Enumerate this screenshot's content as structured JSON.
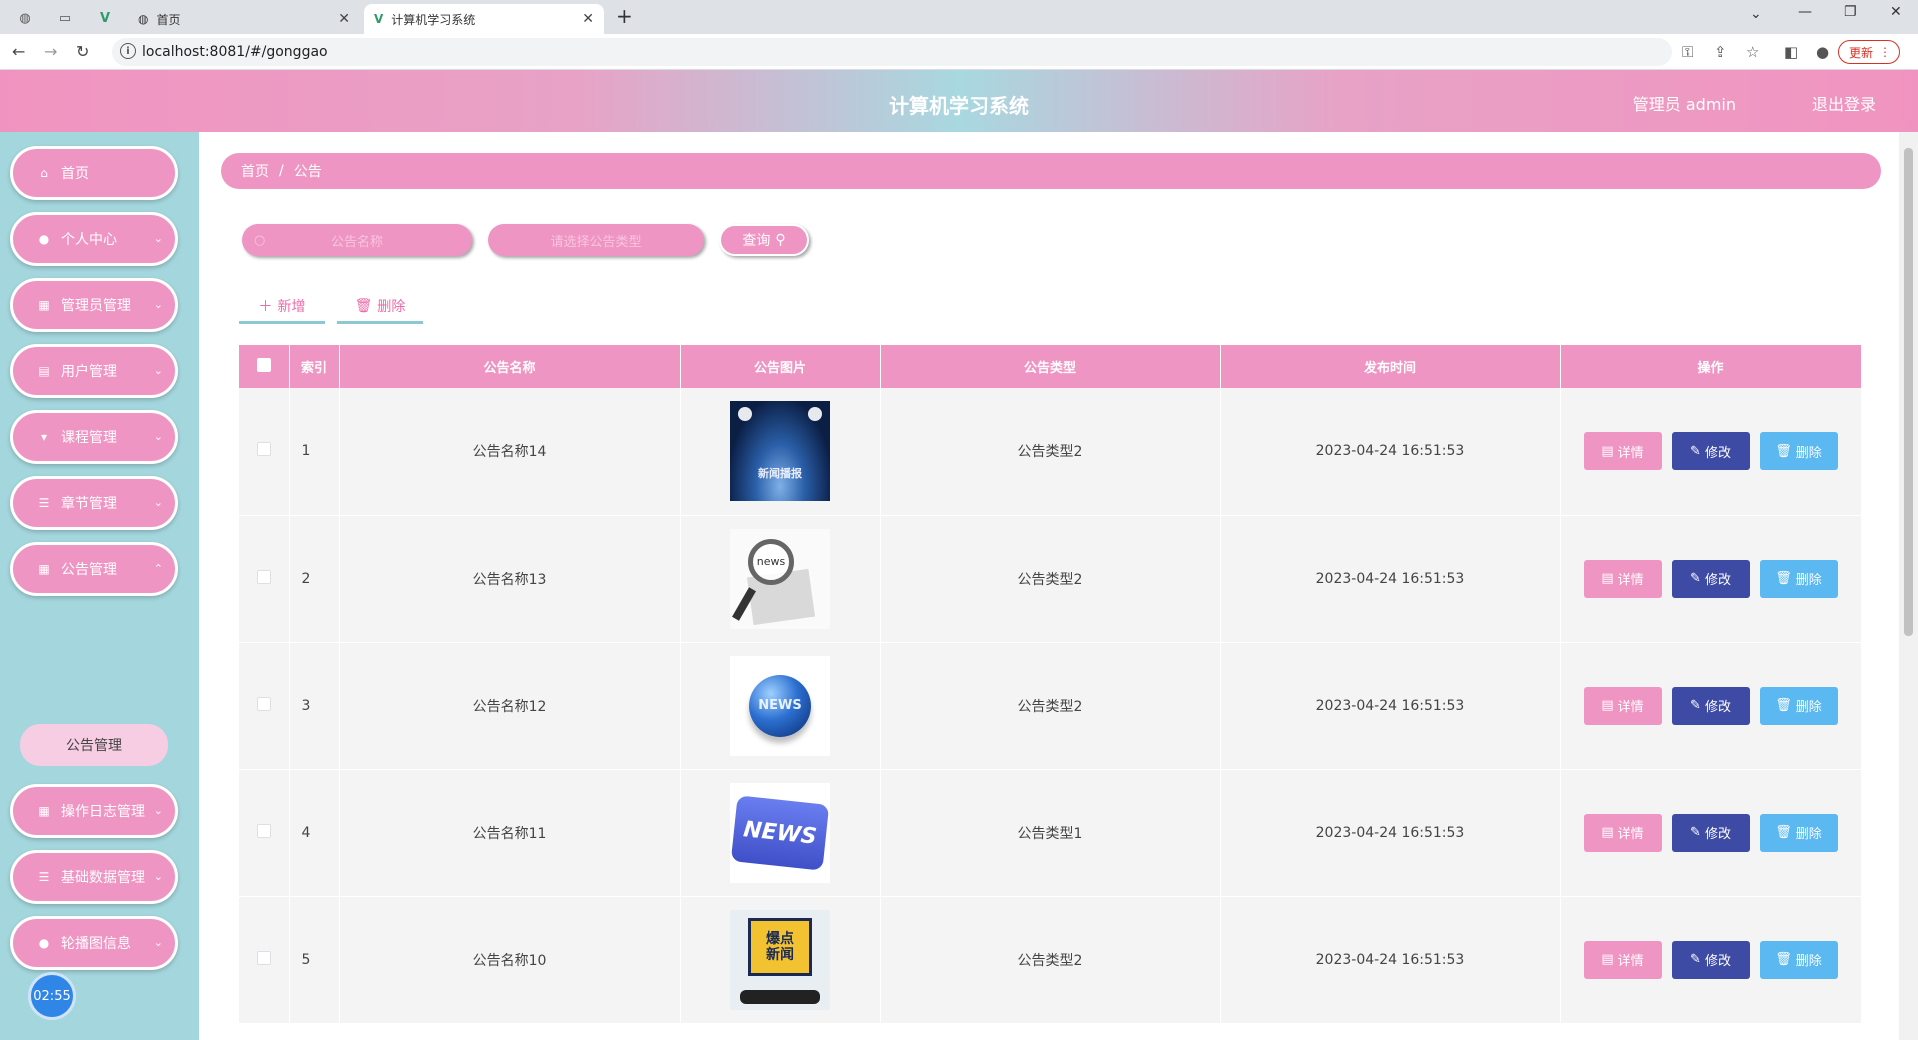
{
  "browser": {
    "tabs": [
      {
        "label": "首页"
      },
      {
        "label": "计算机学习系统"
      }
    ],
    "url": "localhost:8081/#/gonggao",
    "update_label": "更新"
  },
  "header": {
    "title": "计算机学习系统",
    "admin_label": "管理员 admin",
    "logout_label": "退出登录"
  },
  "sidebar": {
    "items": [
      {
        "label": "首页",
        "icon": "home-icon"
      },
      {
        "label": "个人中心",
        "icon": "user-icon"
      },
      {
        "label": "管理员管理",
        "icon": "grid-icon"
      },
      {
        "label": "用户管理",
        "icon": "clipboard-icon"
      },
      {
        "label": "课程管理",
        "icon": "podium-icon"
      },
      {
        "label": "章节管理",
        "icon": "list-icon"
      },
      {
        "label": "公告管理",
        "icon": "grid-icon"
      },
      {
        "label": "操作日志管理",
        "icon": "grid-icon"
      },
      {
        "label": "基础数据管理",
        "icon": "list-icon"
      },
      {
        "label": "轮播图信息",
        "icon": "location-icon"
      }
    ],
    "active_submenu": "公告管理",
    "clock": "02:55"
  },
  "breadcrumb": {
    "home": "首页",
    "current": "公告"
  },
  "search": {
    "name_placeholder": "公告名称",
    "type_placeholder": "请选择公告类型",
    "query_label": "查询"
  },
  "actions": {
    "add_label": "新增",
    "delete_label": "删除"
  },
  "table": {
    "headers": [
      "索引",
      "公告名称",
      "公告图片",
      "公告类型",
      "发布时间",
      "操作"
    ],
    "rows": [
      {
        "index": "1",
        "name": "公告名称14",
        "image": "stage-news",
        "type": "公告类型2",
        "time": "2023-04-24 16:51:53"
      },
      {
        "index": "2",
        "name": "公告名称13",
        "image": "magnifier-news",
        "type": "公告类型2",
        "time": "2023-04-24 16:51:53"
      },
      {
        "index": "3",
        "name": "公告名称12",
        "image": "globe-news",
        "type": "公告类型2",
        "time": "2023-04-24 16:51:53"
      },
      {
        "index": "4",
        "name": "公告名称11",
        "image": "news-key",
        "type": "公告类型1",
        "time": "2023-04-24 16:51:53"
      },
      {
        "index": "5",
        "name": "公告名称10",
        "image": "breaking-news-phone",
        "type": "公告类型2",
        "time": "2023-04-24 16:51:53"
      }
    ],
    "op_labels": {
      "detail": "详情",
      "edit": "修改",
      "delete": "删除"
    }
  },
  "image_texts": {
    "stage": "新闻播报",
    "magnifier": "news",
    "globe": "NEWS",
    "key": "NEWS",
    "phone": "爆点新闻"
  }
}
